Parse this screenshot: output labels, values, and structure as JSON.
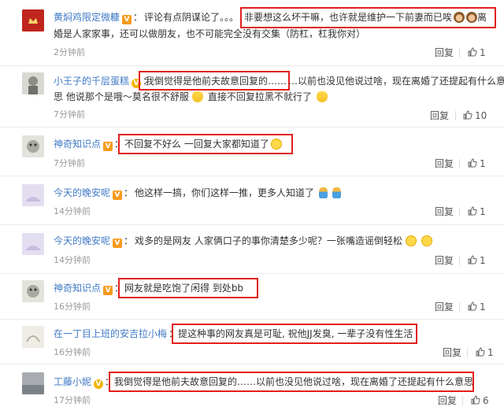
{
  "comments": [
    {
      "username": "黄焖鸡限定微糠",
      "line1": "评论有点阴谋论了。。。",
      "line1_boxed": "非要想这么坏干嘛，也许就是维护一下前妻而已唉",
      "line1_tail": "离",
      "line2": "婚是人家家事，还可以做朋友，也不可能完全没有交集（防杠，杠我你对）",
      "time": "2分钟前",
      "reply": "回复",
      "likes": "1"
    },
    {
      "username": "小王子的千层蛋糕",
      "line1_boxed": "我倒觉得是他前夫故意回复的……",
      "line1": "…以前也没见他说过啥，现在离婚了还提起有什么意",
      "line2": "思 他说那个是哦～莫名很不舒服",
      "line2_tail": "直接不回复拉黑不就行了",
      "time": "7分钟前",
      "reply": "回复",
      "likes": "10"
    },
    {
      "username": "神奇知识点",
      "line1_boxed": "不回复不好么 一回复大家都知道了",
      "time": "7分钟前",
      "reply": "回复",
      "likes": "1"
    },
    {
      "username": "今天的晚安呢",
      "line1": "他这样一搞，你们这样一推，更多人知道了",
      "time": "14分钟前",
      "reply": "回复",
      "likes": "1"
    },
    {
      "username": "今天的晚安呢",
      "line1": "戏多的是网友 人家俩口子的事你清楚多少呢？一张嘴造谣倒轻松",
      "time": "14分钟前",
      "reply": "回复",
      "likes": "1"
    },
    {
      "username": "神奇知识点",
      "line1_boxed": "网友就是吃饱了闲得 到处bb",
      "time": "16分钟前",
      "reply": "回复",
      "likes": "1"
    },
    {
      "username": "在一丁目上班的安吉拉小梅",
      "line1_boxed": "提这种事的网友真是可耻, 祝他JJ发臭, 一辈子没有性生活",
      "time": "16分钟前",
      "reply": "回复",
      "likes": "1"
    },
    {
      "username": "工藤小妮",
      "line1_boxed": "我倒觉得是他前夫故意回复的……以前也没见他说过啥，现在离婚了还提起有什么意思",
      "time": "17分钟前",
      "reply": "回复",
      "likes": "6"
    }
  ],
  "colors": {
    "username": "#3f79c5",
    "highlight_box": "#e02020",
    "meta": "#999999"
  }
}
